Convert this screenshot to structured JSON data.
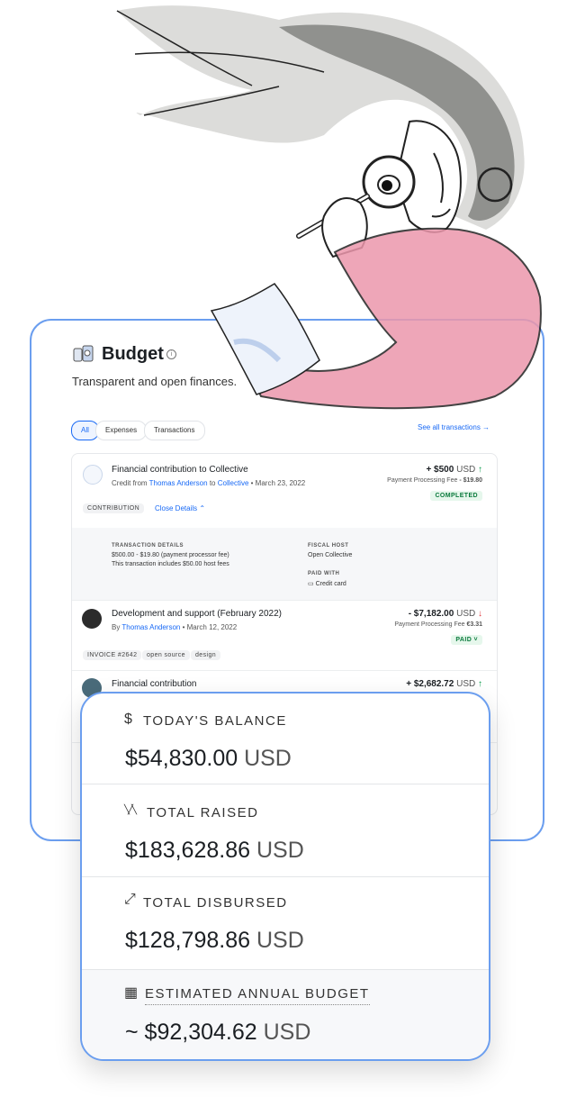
{
  "budget": {
    "title": "Budget",
    "subtitle": "Transparent and open finances.",
    "filters": [
      "All",
      "Expenses",
      "Transactions"
    ],
    "see_all": "See all transactions →"
  },
  "transactions": [
    {
      "title": "Financial contribution to Collective",
      "meta_prefix": "Credit from",
      "from": "Thomas Anderson",
      "to_word": "to",
      "to": "Collective",
      "date": "• March 23, 2022",
      "amount": "+ $500",
      "currency": "USD",
      "fee_label": "Payment Processing Fee",
      "fee": "- $19.80",
      "status": "COMPLETED",
      "tag": "CONTRIBUTION",
      "toggle": "Close Details ⌃",
      "details": {
        "td_label": "TRANSACTION DETAILS",
        "td_line1": "$500.00 - $19.80 (payment processor fee)",
        "td_line2": "This transaction includes $50.00 host fees",
        "fh_label": "FISCAL HOST",
        "fh_value": "Open Collective",
        "pw_label": "PAID WITH",
        "pw_value": "Credit card"
      }
    },
    {
      "title": "Development and support (February 2022)",
      "meta_prefix": "By",
      "from": "Thomas Anderson",
      "date": "• March 12, 2022",
      "amount": "- $7,182.00",
      "currency": "USD",
      "fee_label": "Payment Processing Fee",
      "fee": "€3.31",
      "status": "PAID ˅",
      "tags": [
        "INVOICE #2642",
        "open source",
        "design"
      ]
    },
    {
      "title": "Financial contribution",
      "amount": "+ $2,682.72",
      "currency": "USD"
    }
  ],
  "stats": [
    {
      "icon": "$",
      "label": "TODAY'S BALANCE",
      "amount": "$54,830.00",
      "currency": "USD"
    },
    {
      "icon": "╲╱╲",
      "label": "TOTAL RAISED",
      "amount": "$183,628.86",
      "currency": "USD"
    },
    {
      "icon": "⤢",
      "label": "TOTAL DISBURSED",
      "amount": "$128,798.86",
      "currency": "USD"
    },
    {
      "icon": "▦",
      "label": "ESTIMATED ANNUAL BUDGET",
      "amount": "~ $92,304.62",
      "currency": "USD"
    }
  ],
  "colors": {
    "accent": "#1869f5",
    "card_border": "#6b9eef",
    "positive": "#0a9a4a",
    "negative": "#e0393e"
  }
}
